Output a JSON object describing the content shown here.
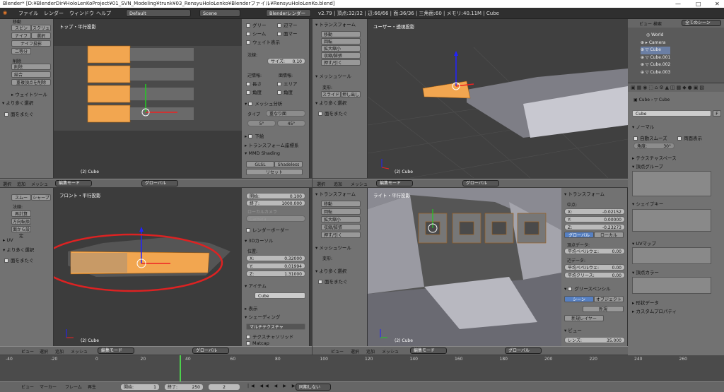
{
  "window": {
    "title": "Blender* [D:¥BlenderDir¥HoloLenKoProject¥01_SVN_Modeling¥trunk¥03_RensyuHoloLenko¥Blenderファイル¥RensyuHoloLenKo.blend]",
    "min": "—",
    "max": "□",
    "close": "✕"
  },
  "info": {
    "menus": [
      "ファイル",
      "レンダー",
      "ウィンドウ",
      "ヘルプ"
    ],
    "layout": "Default",
    "scene": "Scene",
    "engine": "Blenderレンダー",
    "stats": "v2.79 | 頂点:32/32 | 辺:66/66 | 面:36/36 | 三角面:60 | メモリ:40.11M | Cube"
  },
  "tl_panel": {
    "head": "移動",
    "buttons": [
      "スピン",
      "スクリュー",
      "ナイフ",
      "選択",
      "ナイフ投影",
      "二等分"
    ],
    "del": "削除",
    "del_btn": "削除",
    "merge": "結合",
    "remove_dup": "重複頂点を削除",
    "weight_tool": "ウェイトツール",
    "more_sel": "より多く選択",
    "face_adj": "面をまたぐ"
  },
  "tl_view": {
    "title": "トップ・平行投影",
    "obj": "(2) Cube"
  },
  "tl_right": {
    "col": [
      "グリー",
      "シーム",
      "ウェイト表示"
    ],
    "col2": [
      "辺マー",
      "面マー"
    ],
    "normal": "法線:",
    "normal_size": "サイズ:",
    "normal_val": "0.10",
    "edge_info": "辺情報:",
    "face_info": "面情報:",
    "len": "長さ",
    "area": "エリア",
    "angle1": "角度",
    "angle2": "角度",
    "mesh_analysis": "メッシュ分析",
    "type": "タイプ",
    "type_val": "重なり面",
    "deg1": "5°",
    "deg2": "45°",
    "sub": "下絵",
    "transform_coords": "トランスフォーム座標系",
    "mmd": "MMD Shading",
    "glsl": "GLSL",
    "shadeless": "Shadeless",
    "reset": "リセット"
  },
  "tr_panel": {
    "head": "トランスフォーム",
    "buttons": [
      "移動",
      "回転",
      "拡大縮小",
      "収縮/膨張",
      "押す/引く"
    ],
    "mesh_tools": "メッシュツール",
    "deform": "変形:",
    "slide": "スライド",
    "extrude": "押し出し",
    "more_sel": "より多く選択",
    "face_adj": "面をまたぐ"
  },
  "tr_view": {
    "title": "ユーザー・透視投影",
    "obj": "(2) Cube"
  },
  "outliner": {
    "view": "ビュー",
    "search": "検索",
    "all_scenes": "全てのシーン",
    "items": [
      "World",
      "Camera",
      "Cube",
      "Cube.001",
      "Cube.002",
      "Cube.003"
    ]
  },
  "props": {
    "crumb1": "Cube",
    "crumb2": "Cube",
    "name": "Cube",
    "name_f": "F",
    "normal": "ノーマル",
    "auto_smooth": "自動スムーズ",
    "double_side": "両面表示",
    "angle": "角度:",
    "angle_val": "30°",
    "tex_space": "テクスチャスペース",
    "vgroups": "頂点グループ",
    "shape_keys": "シェイプキー",
    "uv": "UVマップ",
    "vcol": "頂点カラー",
    "shape_data": "形状データ",
    "custom_props": "カスタムプロパティ"
  },
  "header_mid": {
    "menus": [
      "選択",
      "追加",
      "メッシュ"
    ],
    "mode": "編集モード",
    "orient": "グローバル"
  },
  "bl_panel": {
    "items": [
      "スムー",
      "シャープ",
      "法線:",
      "再計算",
      "方向転換",
      "面から設定"
    ],
    "uv": "UV",
    "more_sel": "より多く選択",
    "face_adj": "面をまたぐ"
  },
  "bl_view": {
    "title": "フロント・平行投影",
    "obj": "(2) Cube"
  },
  "bl_right": {
    "start": "開始:",
    "start_val": "0.100",
    "end": "終了:",
    "end_val": "1000.000",
    "local_cam": "ローカルカメラ",
    "camera": "Camera",
    "render_border": "レンダーボーダー",
    "cursor": "3Dカーソル",
    "pos": "位置:",
    "x": "X:",
    "xv": "0.32000",
    "y": "Y:",
    "yv": "0.01994",
    "z": "Z:",
    "zv": "1.31000",
    "item": "アイテム",
    "item_name": "Cube",
    "display": "表示",
    "shading": "シェーディング",
    "multitex": "マルチテクスチャ",
    "tex_solid": "テクスチャソリッド",
    "matcap": "Matcap"
  },
  "br_panel": {
    "head": "トランスフォーム",
    "buttons": [
      "移動",
      "回転",
      "拡大縮小",
      "収縮/膨張",
      "押す/引く"
    ],
    "mesh_tools": "メッシュツール",
    "deform": "変形:",
    "more_sel": "より多く選択",
    "face_adj": "面をまたぐ"
  },
  "br_view": {
    "title": "ライト・平行投影",
    "obj": "(2) Cube"
  },
  "br_right": {
    "transform": "トランスフォーム",
    "median": "中点:",
    "x": "X:",
    "xv": "-0.02152",
    "y": "Y:",
    "yv": "0.00000",
    "z": "Z:",
    "zv": "-0.23273",
    "global": "グローバル",
    "local": "ローカル",
    "vdata": "頂点データ:",
    "bevel_w": "平均ベベルウェ:",
    "bw_val": "0.00",
    "edata": "辺データ:",
    "bevel_w2": "平均ベベルウェ:",
    "bw2_val": "0.00",
    "crease": "平均クリース:",
    "cr_val": "0.00",
    "gpencil": "グリースペンシル",
    "scene": "シーン",
    "object": "オブジェクト",
    "new": "新規",
    "new_layer": "新規レイヤー",
    "view": "ビュー",
    "lens": "レンズ:",
    "lens_val": "35.000"
  },
  "header_bottom": {
    "menus": [
      "ビュー",
      "選択",
      "追加",
      "メッシュ"
    ],
    "mode": "編集モード",
    "orient": "グローバル"
  },
  "timeline": {
    "ticks": [
      "-40",
      "-20",
      "0",
      "20",
      "40",
      "60",
      "80",
      "100",
      "120",
      "140",
      "160",
      "180",
      "200",
      "220",
      "240",
      "260"
    ],
    "menus": [
      "ビュー",
      "マーカー",
      "フレーム",
      "再生"
    ],
    "start": "開始:",
    "start_v": "1",
    "end": "終了:",
    "end_v": "250",
    "cur": "2",
    "sync": "同期しない"
  },
  "colors": {
    "select": "#f2a650",
    "accent": "#5680c2",
    "red_circle": "#d22"
  }
}
